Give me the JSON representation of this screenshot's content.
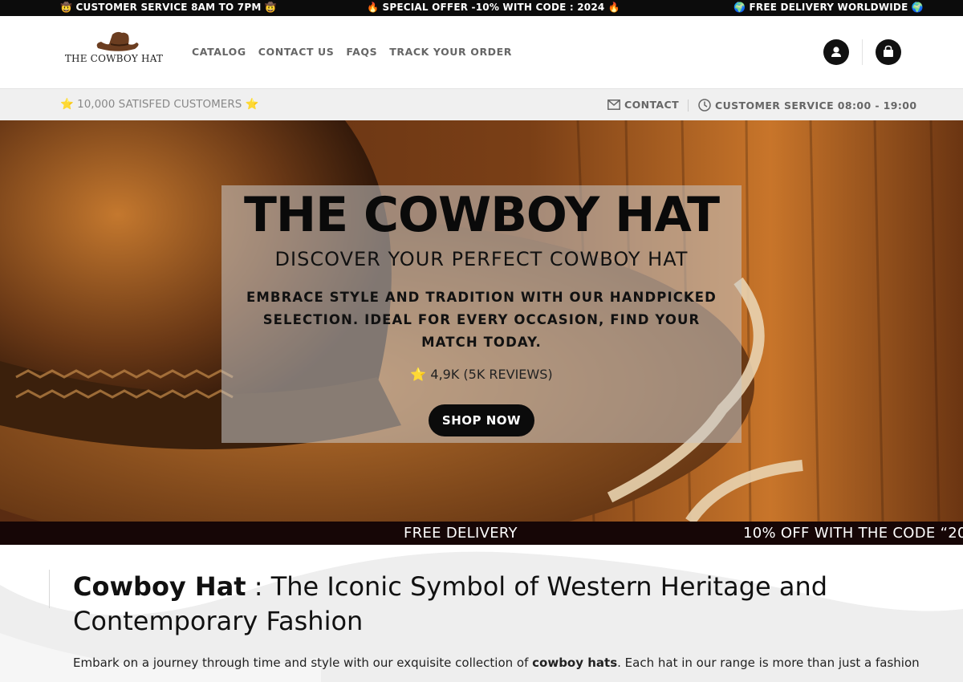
{
  "announcement": {
    "left": "🤠 CUSTOMER SERVICE 8AM TO 7PM 🤠",
    "center": "🔥 SPECIAL OFFER -10% WITH CODE : 2024 🔥",
    "right": "🌍 FREE DELIVERY WORLDWIDE 🌍"
  },
  "header": {
    "logo_text": "THE COWBOY HAT",
    "nav": [
      "CATALOG",
      "CONTACT US",
      "FAQS",
      "TRACK YOUR ORDER"
    ],
    "account_icon": "user-icon",
    "cart_icon": "shopping-bag-icon"
  },
  "subbar": {
    "satisfied": "⭐ 10,000 SATISFED CUSTOMERS ⭐",
    "contact_label": "CONTACT",
    "service_label": "CUSTOMER SERVICE 08:00 - 19:00",
    "contact_icon": "envelope-icon",
    "service_icon": "clock-icon"
  },
  "hero": {
    "title": "THE COWBOY HAT",
    "subtitle": "DISCOVER YOUR PERFECT COWBOY HAT",
    "description": "EMBRACE STYLE AND TRADITION WITH OUR HANDPICKED SELECTION. IDEAL FOR EVERY OCCASION, FIND YOUR MATCH TODAY.",
    "rating": "⭐ 4,9K (5K REVIEWS)",
    "cta": "SHOP NOW"
  },
  "marquee": {
    "item1": "FREE DELIVERY",
    "item2": "10% OFF WITH THE CODE “20"
  },
  "content": {
    "heading_bold": "Cowboy Hat",
    "heading_rest": " : The Iconic Symbol of Western Heritage and Contemporary Fashion",
    "para_start": "Embark on a journey through time and style with our exquisite collection of ",
    "para_bold": "cowboy hats",
    "para_end": ". Each hat in our range is more than just a fashion"
  },
  "colors": {
    "topbar_bg": "#0c0c0c",
    "subbar_bg": "#f0f0f0",
    "marquee_bg": "#160606",
    "button_bg": "#0b0b0b"
  }
}
